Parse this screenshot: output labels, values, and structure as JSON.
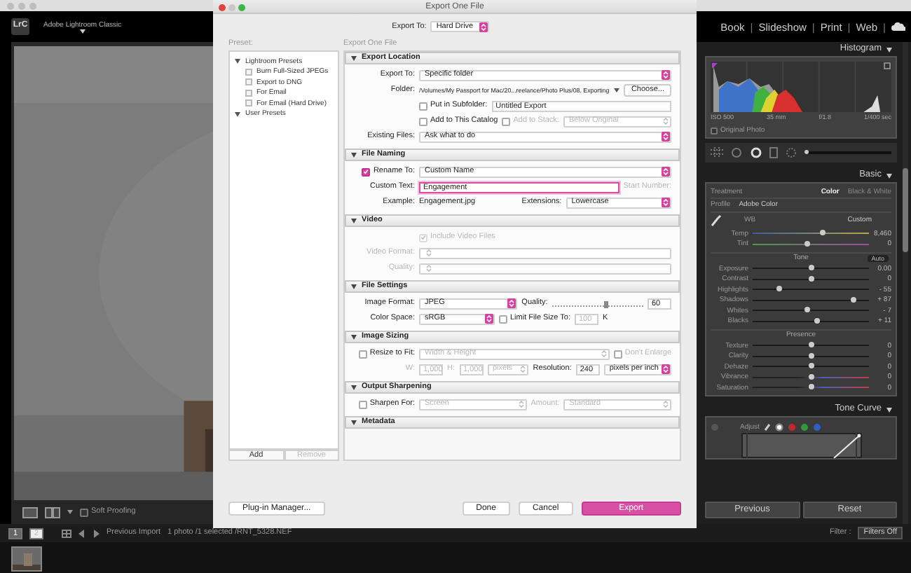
{
  "app": {
    "logo": "LrC",
    "title": "Adobe Lightroom Classic",
    "modules": [
      "Book",
      "Slideshow",
      "Print",
      "Web"
    ],
    "module_separators": [
      "|",
      "|",
      "|",
      "|"
    ]
  },
  "toolbar": {
    "soft_proofing": {
      "label": "Soft Proofing",
      "checked": false
    }
  },
  "filmstrip": {
    "screens": [
      {
        "label": "1",
        "selected": true
      },
      {
        "label": "2",
        "selected": false
      }
    ],
    "source": "Previous Import",
    "info": "1 photo /1 selected /RNT_5328.NEF",
    "filter_label": "Filter :",
    "filter": "Filters Off"
  },
  "right_panel": {
    "histogram": {
      "title": "Histogram",
      "expanded": true,
      "info": [
        "ISO 500",
        "35 mm",
        "f/1.8",
        "1/400 sec"
      ],
      "original_photo": {
        "label": "Original Photo",
        "checked": false
      }
    },
    "tool_slider": {
      "level": 0.04
    },
    "basic": {
      "title": "Basic",
      "expanded": true,
      "treatment_label": "Treatment",
      "treatments": [
        {
          "label": "Color",
          "selected": true
        },
        {
          "label": "Black & White",
          "selected": false
        }
      ],
      "profile_label": "Profile",
      "profile": "Adobe Color",
      "wb_label": "WB",
      "wb": "Custom",
      "groups": [
        {
          "sliders": [
            {
              "label": "Temp",
              "reading": "8,460",
              "level": 0.6,
              "kind": "temperature"
            },
            {
              "label": "Tint",
              "reading": "0",
              "level": 0.47,
              "kind": "tint"
            }
          ]
        },
        {
          "heading": "Tone",
          "action": "Auto",
          "sliders": [
            {
              "label": "Exposure",
              "reading": "0.00",
              "level": 0.5,
              "kind": "plain"
            },
            {
              "label": "Contrast",
              "reading": "0",
              "level": 0.5,
              "kind": "plain"
            },
            {
              "label": "Highlights",
              "reading": "- 55",
              "level": 0.23,
              "kind": "plain"
            },
            {
              "label": "Shadows",
              "reading": "+ 87",
              "level": 0.87,
              "kind": "plain"
            },
            {
              "label": "Whites",
              "reading": "- 7",
              "level": 0.47,
              "kind": "plain"
            },
            {
              "label": "Blacks",
              "reading": "+ 11",
              "level": 0.55,
              "kind": "plain"
            }
          ]
        },
        {
          "heading": "Presence",
          "sliders": [
            {
              "label": "Texture",
              "reading": "0",
              "level": 0.5,
              "kind": "plain"
            },
            {
              "label": "Clarity",
              "reading": "0",
              "level": 0.5,
              "kind": "plain"
            },
            {
              "label": "Dehaze",
              "reading": "0",
              "level": 0.5,
              "kind": "plain"
            },
            {
              "label": "Vibrance",
              "reading": "0",
              "level": 0.5,
              "kind": "saturation"
            },
            {
              "label": "Saturation",
              "reading": "0",
              "level": 0.5,
              "kind": "saturation"
            }
          ]
        }
      ]
    },
    "tone_curve": {
      "title": "Tone Curve",
      "expanded": true,
      "adjust_label": "Adjust",
      "channels": [
        {
          "color": "#ffffff",
          "selected": true
        },
        {
          "color": "#c0282e",
          "selected": false
        },
        {
          "color": "#2f9a3a",
          "selected": false
        },
        {
          "color": "#2f5fc0",
          "selected": false
        }
      ]
    },
    "buttons": [
      "Previous",
      "Reset"
    ]
  },
  "dialog": {
    "title": "Export One File",
    "export_to_label": "Export To:",
    "export_to": "Hard Drive",
    "preset_label": "Preset:",
    "content_label": "Export One File",
    "presets": [
      {
        "label": "Lightroom Presets",
        "expanded": true,
        "children": [
          {
            "label": "Burn Full-Sized JPEGs"
          },
          {
            "label": "Export to DNG"
          },
          {
            "label": "For Email"
          },
          {
            "label": "For Email (Hard Drive)"
          }
        ]
      },
      {
        "label": "User Presets",
        "expanded": true
      }
    ],
    "preset_buttons": [
      {
        "label": "Add",
        "disabled": false
      },
      {
        "label": "Remove",
        "disabled": true
      }
    ],
    "sections": [
      {
        "title": "Export Location",
        "expanded": true,
        "rows": [
          {
            "kind": "field",
            "items": [
              {
                "kind": "label",
                "text": "Export To:"
              },
              {
                "kind": "select",
                "text": "Specific folder"
              }
            ]
          },
          {
            "kind": "field",
            "items": [
              {
                "kind": "label",
                "text": "Folder:"
              },
              {
                "kind": "path",
                "text": "/Volumes/My Passport for Mac/20...reelance/Photo Plus/08. Exporting"
              },
              {
                "kind": "caret"
              },
              {
                "kind": "button",
                "text": "Choose..."
              }
            ]
          },
          {
            "kind": "option",
            "items": [
              {
                "kind": "checkbox",
                "text": "Put in Subfolder:",
                "checked": false
              },
              {
                "kind": "input",
                "text": "Untitled Export"
              }
            ]
          },
          {
            "kind": "option",
            "items": [
              {
                "kind": "checkbox",
                "text": "Add to This Catalog",
                "checked": false
              },
              {
                "kind": "checkbox",
                "text": "Add to Stack:",
                "checked": false,
                "disabled": true
              },
              {
                "kind": "select",
                "text": "Below Original",
                "disabled": true
              }
            ]
          },
          {
            "kind": "field",
            "items": [
              {
                "kind": "label",
                "text": "Existing Files:"
              },
              {
                "kind": "select",
                "text": "Ask what to do"
              }
            ]
          }
        ]
      },
      {
        "title": "File Naming",
        "expanded": true,
        "rows": [
          {
            "kind": "field",
            "items": [
              {
                "kind": "checkbox",
                "text": "Rename To:",
                "checked": true
              },
              {
                "kind": "select",
                "text": "Custom Name"
              }
            ]
          },
          {
            "kind": "field",
            "items": [
              {
                "kind": "label",
                "text": "Custom Text:"
              },
              {
                "kind": "input",
                "text": "Engagement",
                "focused": true
              },
              {
                "kind": "label",
                "text": "Start Number:",
                "disabled": true
              }
            ]
          },
          {
            "kind": "field",
            "items": [
              {
                "kind": "label",
                "text": "Example:"
              },
              {
                "kind": "text",
                "text": "Engagement.jpg"
              },
              {
                "kind": "label",
                "text": "Extensions:"
              },
              {
                "kind": "select",
                "text": "Lowercase"
              }
            ]
          }
        ]
      },
      {
        "title": "Video",
        "expanded": true,
        "rows": [
          {
            "kind": "option",
            "items": [
              {
                "kind": "checkbox",
                "text": "Include Video Files",
                "checked": true,
                "disabled": true
              }
            ]
          },
          {
            "kind": "field",
            "items": [
              {
                "kind": "label",
                "text": "Video Format:",
                "disabled": true
              },
              {
                "kind": "select",
                "disabled": true
              }
            ]
          },
          {
            "kind": "field",
            "items": [
              {
                "kind": "label",
                "text": "Quality:",
                "disabled": true
              },
              {
                "kind": "select",
                "disabled": true
              }
            ]
          }
        ]
      },
      {
        "title": "File Settings",
        "expanded": true,
        "rows": [
          {
            "kind": "field",
            "items": [
              {
                "kind": "label",
                "text": "Image Format:"
              },
              {
                "kind": "select",
                "text": "JPEG"
              },
              {
                "kind": "label",
                "text": "Quality:"
              },
              {
                "kind": "slider",
                "level": 0.6
              },
              {
                "kind": "number",
                "text": "60"
              }
            ]
          },
          {
            "kind": "field",
            "items": [
              {
                "kind": "label",
                "text": "Color Space:"
              },
              {
                "kind": "select",
                "text": "sRGB"
              },
              {
                "kind": "checkbox",
                "text": "Limit File Size To:",
                "checked": false
              },
              {
                "kind": "number",
                "text": "100",
                "disabled": true
              },
              {
                "kind": "text",
                "text": "K"
              }
            ]
          }
        ]
      },
      {
        "title": "Image Sizing",
        "expanded": true,
        "rows": [
          {
            "kind": "field",
            "items": [
              {
                "kind": "checkbox",
                "text": "Resize to Fit:",
                "checked": false
              },
              {
                "kind": "select",
                "text": "Width & Height",
                "disabled": true
              },
              {
                "kind": "checkbox",
                "text": "Don't Enlarge",
                "checked": false,
                "disabled": true
              }
            ]
          },
          {
            "kind": "field",
            "items": [
              {
                "kind": "label",
                "text": "W:",
                "disabled": true
              },
              {
                "kind": "number",
                "text": "1,000",
                "disabled": true
              },
              {
                "kind": "label",
                "text": "H:",
                "disabled": true
              },
              {
                "kind": "number",
                "text": "1,000",
                "disabled": true
              },
              {
                "kind": "select",
                "text": "pixels",
                "disabled": true
              },
              {
                "kind": "label",
                "text": "Resolution:"
              },
              {
                "kind": "number",
                "text": "240"
              },
              {
                "kind": "select",
                "text": "pixels per inch"
              }
            ]
          }
        ]
      },
      {
        "title": "Output Sharpening",
        "expanded": true,
        "rows": [
          {
            "kind": "field",
            "items": [
              {
                "kind": "checkbox",
                "text": "Sharpen For:",
                "checked": false
              },
              {
                "kind": "select",
                "text": "Screen",
                "disabled": true
              },
              {
                "kind": "label",
                "text": "Amount:",
                "disabled": true
              },
              {
                "kind": "select",
                "text": "Standard",
                "disabled": true
              }
            ]
          }
        ]
      },
      {
        "title": "Metadata",
        "expanded": true
      }
    ],
    "plugin_button": "Plug-in Manager...",
    "buttons": [
      {
        "label": "Done",
        "primary": false
      },
      {
        "label": "Cancel",
        "primary": false
      },
      {
        "label": "Export",
        "primary": true
      }
    ]
  }
}
